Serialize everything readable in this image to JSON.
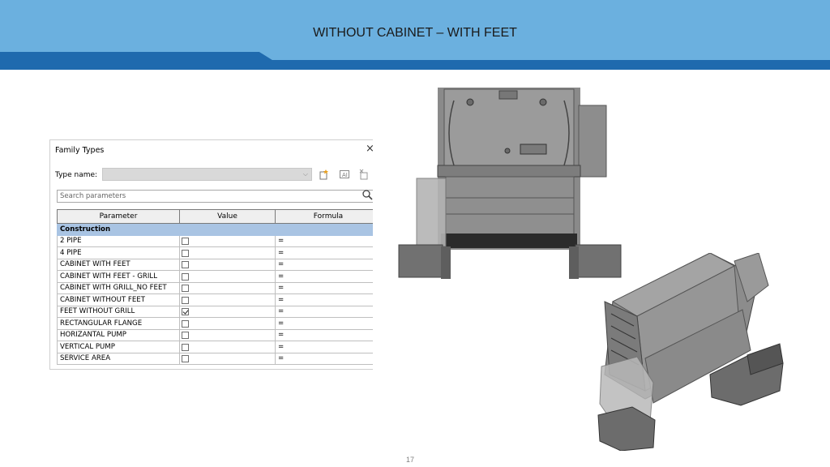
{
  "slide": {
    "title": "WITHOUT CABINET – WITH FEET",
    "page_number": "17",
    "colors": {
      "header_light": "#6bb0df",
      "header_dark": "#1f6aae",
      "group_row": "#a9c4e3"
    }
  },
  "dialog": {
    "title": "Family Types",
    "close_glyph": "×",
    "type_name_label": "Type name:",
    "type_name_value": "",
    "search_placeholder": "Search parameters",
    "columns": [
      "Parameter",
      "Value",
      "Formula"
    ],
    "group": "Construction",
    "rows": [
      {
        "name": "2 PIPE",
        "checked": false,
        "formula": "="
      },
      {
        "name": "4 PIPE",
        "checked": false,
        "formula": "="
      },
      {
        "name": "CABINET WITH FEET",
        "checked": false,
        "formula": "="
      },
      {
        "name": "CABINET WITH FEET - GRILL",
        "checked": false,
        "formula": "="
      },
      {
        "name": "CABINET WITH GRILL_NO FEET",
        "checked": false,
        "formula": "="
      },
      {
        "name": "CABINET WITHOUT FEET",
        "checked": false,
        "formula": "="
      },
      {
        "name": "FEET WITHOUT GRILL",
        "checked": true,
        "formula": "="
      },
      {
        "name": "RECTANGULAR FLANGE",
        "checked": false,
        "formula": "="
      },
      {
        "name": "HORIZANTAL PUMP",
        "checked": false,
        "formula": "="
      },
      {
        "name": "VERTICAL PUMP",
        "checked": false,
        "formula": "="
      },
      {
        "name": "SERVICE AREA",
        "checked": false,
        "formula": "="
      }
    ]
  }
}
